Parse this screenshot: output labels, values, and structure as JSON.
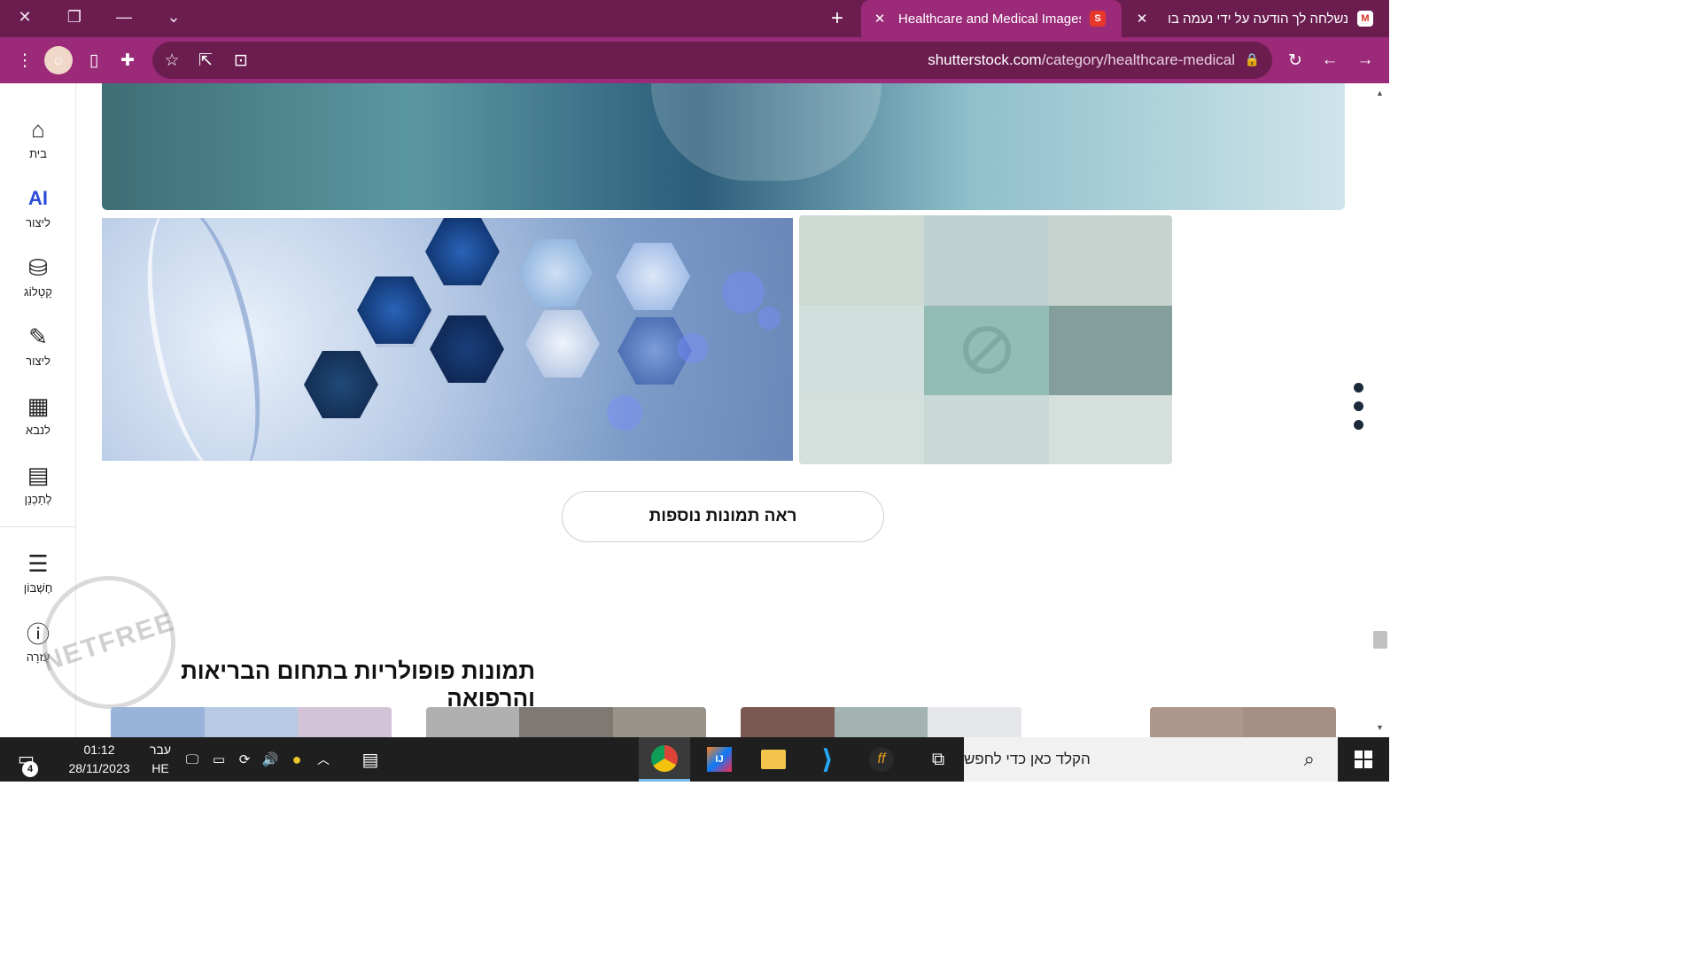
{
  "browser": {
    "tabs": [
      {
        "title": "Healthcare and Medical Images,",
        "active": true,
        "favicon": "shutterstock-icon"
      },
      {
        "title": "נשלחה לך הודעה על ידי נעמה בו",
        "active": false,
        "favicon": "gmail-icon"
      }
    ],
    "url_domain": "shutterstock.com",
    "url_path": "/category/healthcare-medical"
  },
  "sidebar": {
    "items": [
      {
        "label": "בית",
        "icon": "home-icon"
      },
      {
        "label": "ליצור",
        "icon": "ai-generate-icon",
        "glyph": "AI"
      },
      {
        "label": "קָטָלוֹג",
        "icon": "catalog-icon"
      },
      {
        "label": "ליצור",
        "icon": "edit-pencil-icon"
      },
      {
        "label": "לנבא",
        "icon": "predict-grid-icon"
      },
      {
        "label": "לְתַכְנֵן",
        "icon": "calendar-icon"
      },
      {
        "label": "חֶשְׁבּוֹן",
        "icon": "account-list-icon"
      },
      {
        "label": "עֶזרָה",
        "icon": "help-icon"
      }
    ],
    "watermark": "NETFREE"
  },
  "main": {
    "more_button": "ראה תמונות נוספות",
    "section_title": "תמונות פופולריות בתחום הבריאות והרפואה",
    "blocked_colors": [
      "#ced9d4",
      "#bfd2d2",
      "#c7d3ce",
      "#d2e0dd",
      "#93bcb4",
      "#849f9b",
      "#d3e0dc",
      "#c9d9d5",
      "#d5e0dc"
    ],
    "thumbs": [
      {
        "colors": [
          "#99b4d8",
          "#b8cae3",
          "#d3c3d7"
        ]
      },
      {
        "colors": [
          "#b0b0b0",
          "#7f7873",
          "#9a9389"
        ]
      },
      {
        "colors": [
          "#7a5a50",
          "#a2b3b2",
          "#e6e7ea"
        ]
      },
      {
        "colors": [
          "#ad968a",
          "#a68f83"
        ]
      }
    ]
  },
  "taskbar": {
    "search_placeholder": "הקלד כאן כדי לחפש",
    "time": "01:12",
    "date": "28/11/2023",
    "lang_top": "עבר",
    "lang_bottom": "HE",
    "notification_count": "4"
  }
}
